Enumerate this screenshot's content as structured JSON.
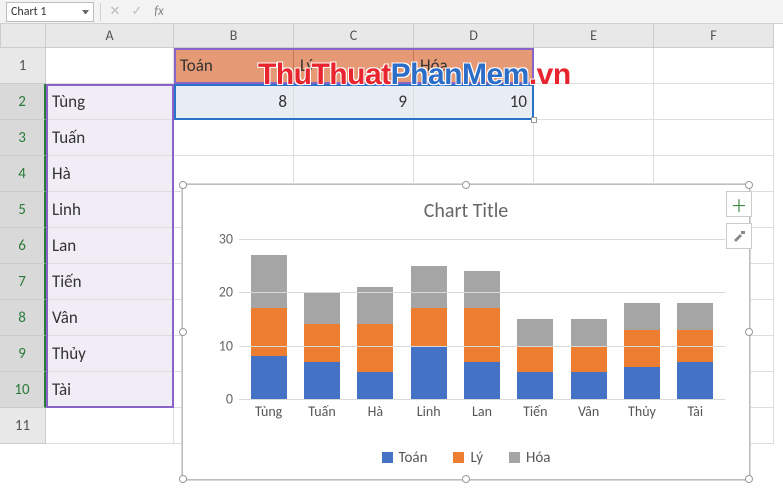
{
  "name_box": "Chart 1",
  "formula": "",
  "columns": [
    "A",
    "B",
    "C",
    "D",
    "E",
    "F"
  ],
  "rows": [
    "1",
    "2",
    "3",
    "4",
    "5",
    "6",
    "7",
    "8",
    "9",
    "10",
    "11"
  ],
  "headers_row1": {
    "B": "Toán",
    "C": "Lý",
    "D": "Hóa"
  },
  "values_row2": {
    "B": "8",
    "C": "9",
    "D": "10"
  },
  "names_colA": [
    "Tùng",
    "Tuấn",
    "Hà",
    "Linh",
    "Lan",
    "Tiến",
    "Vân",
    "Thủy",
    "Tài"
  ],
  "watermark": {
    "a": "ThuThuat",
    "b": "PhanMem",
    "c": ".vn"
  },
  "chart_data": {
    "type": "bar",
    "stacked": true,
    "title": "Chart Title",
    "categories": [
      "Tùng",
      "Tuấn",
      "Hà",
      "Linh",
      "Lan",
      "Tiến",
      "Vân",
      "Thủy",
      "Tài"
    ],
    "series": [
      {
        "name": "Toán",
        "color": "#4472c4",
        "values": [
          8,
          7,
          5,
          10,
          7,
          5,
          5,
          6,
          7
        ]
      },
      {
        "name": "Lý",
        "color": "#ed7d31",
        "values": [
          9,
          7,
          9,
          7,
          10,
          5,
          5,
          7,
          6
        ]
      },
      {
        "name": "Hóa",
        "color": "#a5a5a5",
        "values": [
          10,
          6,
          7,
          8,
          7,
          5,
          5,
          5,
          5
        ]
      }
    ],
    "ylim": [
      0,
      30
    ],
    "yticks": [
      0,
      10,
      20,
      30
    ],
    "ylabel": "",
    "xlabel": ""
  },
  "colors": {
    "series_toan": "#4472c4",
    "series_ly": "#ed7d31",
    "series_hoa": "#a5a5a5"
  }
}
